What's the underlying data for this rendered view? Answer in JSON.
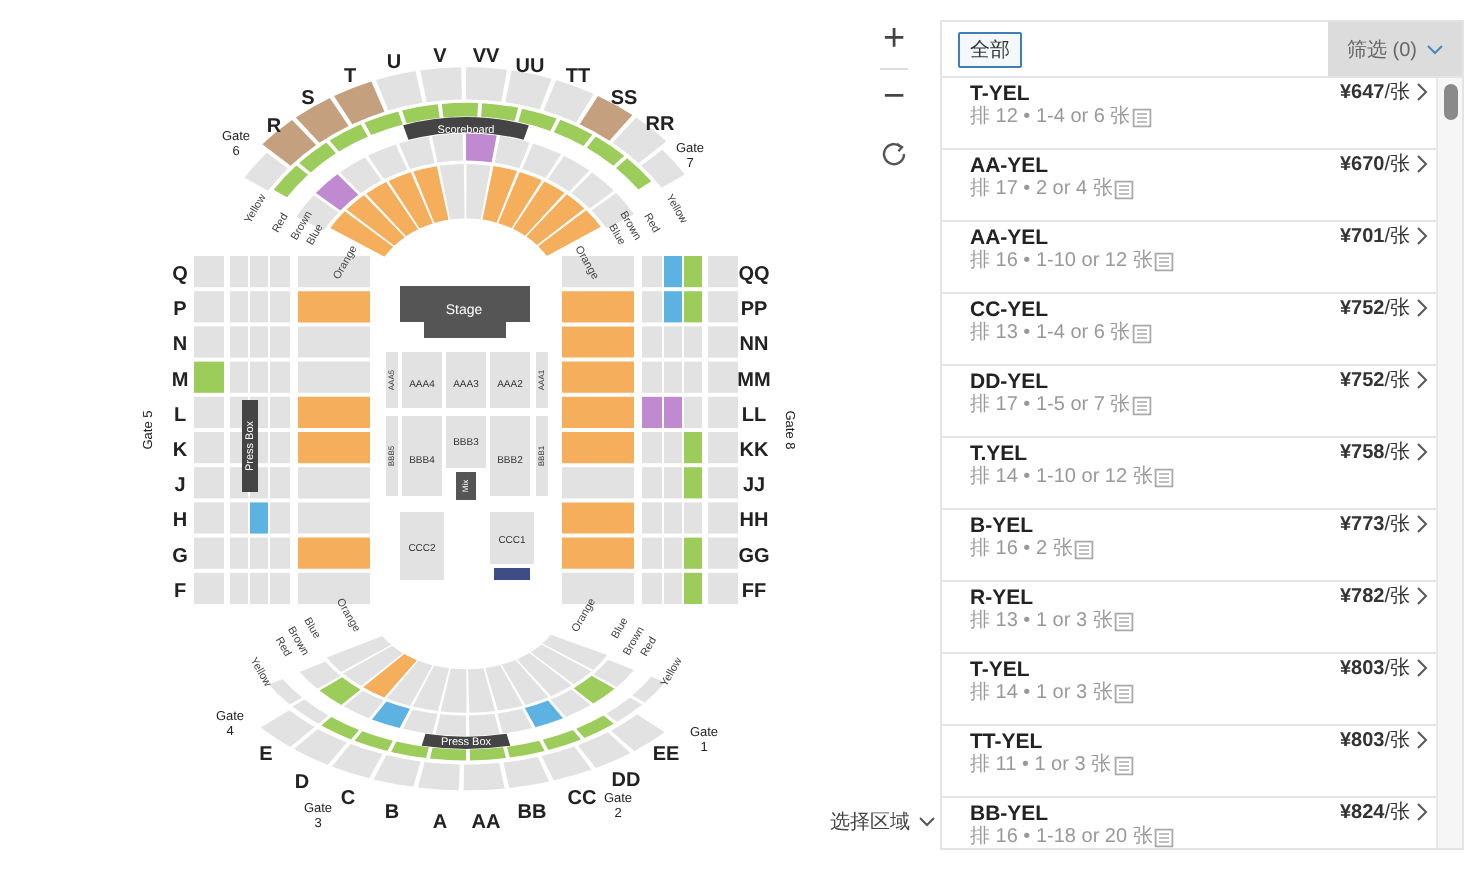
{
  "map": {
    "top_sections": [
      "R",
      "S",
      "T",
      "U",
      "V",
      "VV",
      "UU",
      "TT",
      "SS",
      "RR"
    ],
    "left_sections": [
      "Q",
      "P",
      "N",
      "M",
      "L",
      "K",
      "J",
      "H",
      "G",
      "F"
    ],
    "right_sections": [
      "QQ",
      "PP",
      "NN",
      "MM",
      "LL",
      "KK",
      "JJ",
      "HH",
      "GG",
      "FF"
    ],
    "bottom_sections": [
      "E",
      "D",
      "C",
      "B",
      "A",
      "AA",
      "BB",
      "CC",
      "DD",
      "EE"
    ],
    "gates": [
      "Gate 6",
      "Gate 7",
      "Gate 5",
      "Gate 8",
      "Gate 4",
      "Gate 3",
      "Gate 2",
      "Gate 1"
    ],
    "stage": "Stage",
    "scoreboard": "Scoreboard",
    "press_boxes": [
      "Press Box",
      "Press Box"
    ],
    "floor_rows": [
      [
        "AAA5",
        "AAA4",
        "AAA3",
        "AAA2",
        "AAA1"
      ],
      [
        "BBB5",
        "BBB4",
        "BBB3",
        "BBB2",
        "BBB1"
      ],
      [
        "CCC2",
        "CCC1"
      ]
    ],
    "mix": "Mix",
    "color_lines": [
      [
        "Yellow",
        "Red",
        "Brown",
        "Blue",
        "Orange"
      ],
      [
        "Yellow",
        "Red",
        "Brown",
        "Blue",
        "Orange"
      ],
      [
        "Yellow",
        "Red",
        "Brown",
        "Blue",
        "Orange"
      ],
      [
        "Yellow",
        "Red",
        "Brown",
        "Blue",
        "Orange"
      ]
    ]
  },
  "controls": {
    "zoom_in": "+",
    "zoom_out": "−",
    "area_select": "选择区域"
  },
  "panel": {
    "all_button": "全部",
    "filter": "筛选 (0)",
    "listings": [
      {
        "section": "T-YEL",
        "detail": "排 12 • 1-4 or 6 张",
        "price": "¥647",
        "unit": "/张"
      },
      {
        "section": "AA-YEL",
        "detail": "排 17 • 2 or 4 张",
        "price": "¥670",
        "unit": "/张"
      },
      {
        "section": "AA-YEL",
        "detail": "排 16 • 1-10 or 12 张",
        "price": "¥701",
        "unit": "/张"
      },
      {
        "section": "CC-YEL",
        "detail": "排 13 • 1-4 or 6 张",
        "price": "¥752",
        "unit": "/张"
      },
      {
        "section": "DD-YEL",
        "detail": "排 17 • 1-5 or 7 张",
        "price": "¥752",
        "unit": "/张"
      },
      {
        "section": "T.YEL",
        "detail": "排 14 • 1-10 or 12 张",
        "price": "¥758",
        "unit": "/张"
      },
      {
        "section": "B-YEL",
        "detail": "排 16 • 2 张",
        "price": "¥773",
        "unit": "/张"
      },
      {
        "section": "R-YEL",
        "detail": "排 13 • 1 or 3 张",
        "price": "¥782",
        "unit": "/张"
      },
      {
        "section": "T-YEL",
        "detail": "排 14 • 1 or 3 张",
        "price": "¥803",
        "unit": "/张"
      },
      {
        "section": "TT-YEL",
        "detail": "排 11 • 1 or 3 张",
        "price": "¥803",
        "unit": "/张"
      },
      {
        "section": "BB-YEL",
        "detail": "排 16 • 1-18 or 20 张",
        "price": "¥824",
        "unit": "/张"
      }
    ]
  }
}
